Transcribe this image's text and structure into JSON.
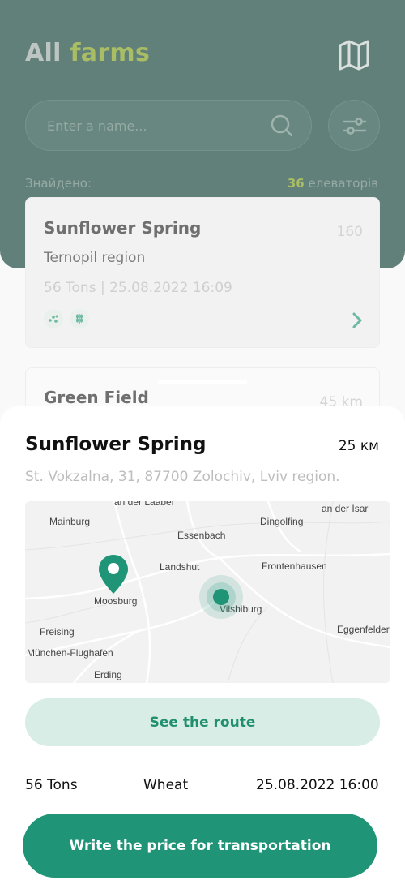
{
  "header": {
    "title_part1": "All",
    "title_part2": "farms",
    "search_placeholder": "Enter a name...",
    "search_value": "",
    "found_label": "Знайдено:",
    "found_count": "36",
    "found_unit": "елеваторів"
  },
  "cards": [
    {
      "name": "Sunflower Spring",
      "distance": "160",
      "region": "Ternopil region",
      "meta": "56 Tons | 25.08.2022  16:09",
      "tags": [
        "seeds-icon",
        "wheat-icon"
      ]
    },
    {
      "name": "Green Field",
      "distance": "45 km"
    }
  ],
  "sheet": {
    "title": "Sunflower Spring",
    "distance": "25 км",
    "address": "St. Vokzalna, 31, 87700 Zolochiv, Lviv region.",
    "map_labels": {
      "mainburg": "Mainburg",
      "dingolfing": "Dingolfing",
      "essenbach": "Essenbach",
      "landshut": "Landshut",
      "frontenhausen": "Frontenhausen",
      "moosburg": "Moosburg",
      "vilsbiburg": "Vilsbiburg",
      "freising": "Freising",
      "eggenfelden": "Eggenfelder",
      "munchen": "München-Flughafen",
      "erding": "Erding",
      "top_left": "an der Laaber",
      "top_right": "an der Isar"
    },
    "route_button": "See the route",
    "info_weight": "56 Tons",
    "info_crop": "Wheat",
    "info_date": "25.08.2022  16:00",
    "price_button": "Write the price for transportation"
  },
  "colors": {
    "header_bg": "#0f3d33",
    "accent_green": "#7c9a12",
    "primary": "#1f9476",
    "route_bg": "#d7ede6"
  }
}
